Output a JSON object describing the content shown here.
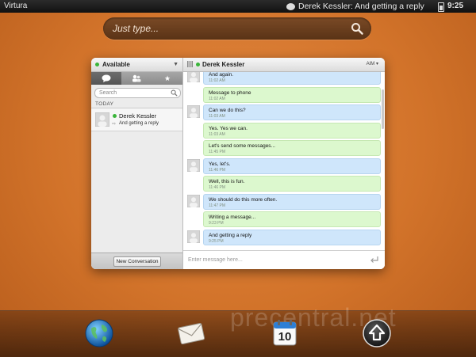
{
  "status_bar": {
    "carrier": "Virtura",
    "notification": "Derek Kessler: And getting a reply",
    "time": "9:25"
  },
  "search": {
    "placeholder": "Just type..."
  },
  "background_text": "p   c",
  "watermark": "precentral.net",
  "messaging": {
    "status": "Available",
    "left_search_placeholder": "Search",
    "section_today": "TODAY",
    "contact": {
      "name": "Derek Kessler",
      "last_message": "And getting a reply",
      "status_color": "#3ab53a"
    },
    "new_conversation_label": "New Conversation",
    "conversation": {
      "name": "Derek Kessler",
      "service": "AIM",
      "compose_placeholder": "Enter message here...",
      "messages": [
        {
          "direction": "in",
          "text": "And again.",
          "time": "11:02 AM"
        },
        {
          "direction": "out",
          "text": "Message to phone",
          "time": "11:02 AM"
        },
        {
          "direction": "in",
          "text": "Can we do this?",
          "time": "11:03 AM"
        },
        {
          "direction": "out",
          "text": "Yes. Yes we can.",
          "time": "11:03 AM"
        },
        {
          "direction": "out",
          "text": "Let's send some messages...",
          "time": "11:45 PM"
        },
        {
          "direction": "in",
          "text": "Yes, let's.",
          "time": "11:46 PM"
        },
        {
          "direction": "out",
          "text": "Well, this is fun.",
          "time": "11:46 PM"
        },
        {
          "direction": "in",
          "text": "We should do this more often.",
          "time": "11:47 PM"
        },
        {
          "direction": "out",
          "text": "Writing a message...",
          "time": "9:23 PM"
        },
        {
          "direction": "in",
          "text": "And getting a reply",
          "time": "9:25 PM"
        }
      ]
    }
  },
  "dock": [
    "globe-icon",
    "email-icon",
    "calendar-icon",
    "launcher-icon"
  ],
  "calendar_day": "10",
  "colors": {
    "incoming": "#cfe6fb",
    "outgoing": "#dcf8ce",
    "wallpaper": "#d2732a"
  }
}
